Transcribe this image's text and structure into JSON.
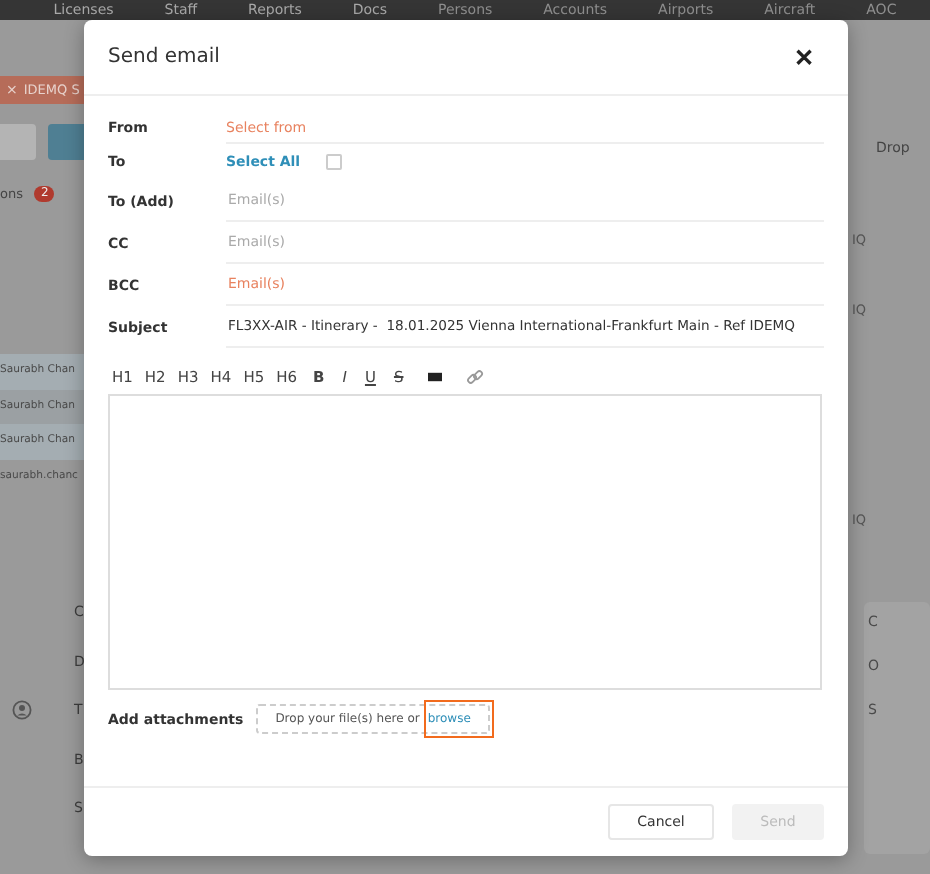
{
  "nav": [
    "Licenses",
    "Staff",
    "Reports",
    "Docs",
    "Persons",
    "Accounts",
    "Airports",
    "Aircraft",
    "AOC"
  ],
  "background": {
    "tab_close": "×",
    "tab": "IDEMQ S",
    "section": "ons",
    "badge": "2",
    "rows": [
      "Saurabh Chan",
      "Saurabh Chan",
      "Saurabh Chan",
      "saurabh.chanc"
    ],
    "left_labels": [
      "C",
      "D",
      "T",
      "B",
      "S"
    ],
    "right_header": "Drop",
    "right_refs": [
      "IQ",
      "IQ",
      "IQ"
    ],
    "right_labels": [
      "C",
      "O",
      "S"
    ]
  },
  "dialog": {
    "title": "Send email",
    "close": "✕",
    "fields": [
      {
        "kind": "select",
        "label": "From",
        "placeholder": "Select from",
        "error": true
      },
      {
        "kind": "select_all",
        "label": "To",
        "link": "Select All",
        "checked": false
      },
      {
        "kind": "email",
        "label": "To (Add)",
        "placeholder": "Email(s)",
        "error": false
      },
      {
        "kind": "email",
        "label": "CC",
        "placeholder": "Email(s)",
        "error": false
      },
      {
        "kind": "email",
        "label": "BCC",
        "placeholder": "Email(s)",
        "error": true
      },
      {
        "kind": "text",
        "label": "Subject",
        "value": "FL3XX-AIR - Itinerary -  18.01.2025 Vienna International-Frankfurt Main - Ref IDEMQ"
      }
    ],
    "toolbar": [
      {
        "kind": "text",
        "label": "H1"
      },
      {
        "kind": "text",
        "label": "H2"
      },
      {
        "kind": "text",
        "label": "H3"
      },
      {
        "kind": "text",
        "label": "H4"
      },
      {
        "kind": "text",
        "label": "H5"
      },
      {
        "kind": "text",
        "label": "H6"
      },
      {
        "kind": "bold",
        "label": "B"
      },
      {
        "kind": "italic",
        "label": "I"
      },
      {
        "kind": "underline",
        "label": "U"
      },
      {
        "kind": "strike",
        "label": "S"
      },
      {
        "kind": "block"
      },
      {
        "kind": "link"
      }
    ],
    "attachments": {
      "label": "Add attachments",
      "drop_text": "Drop your file(s) here or",
      "browse": "browse",
      "highlighted": true
    },
    "buttons": [
      {
        "label": "Cancel",
        "disabled": false
      },
      {
        "label": "Send",
        "disabled": true
      }
    ]
  }
}
